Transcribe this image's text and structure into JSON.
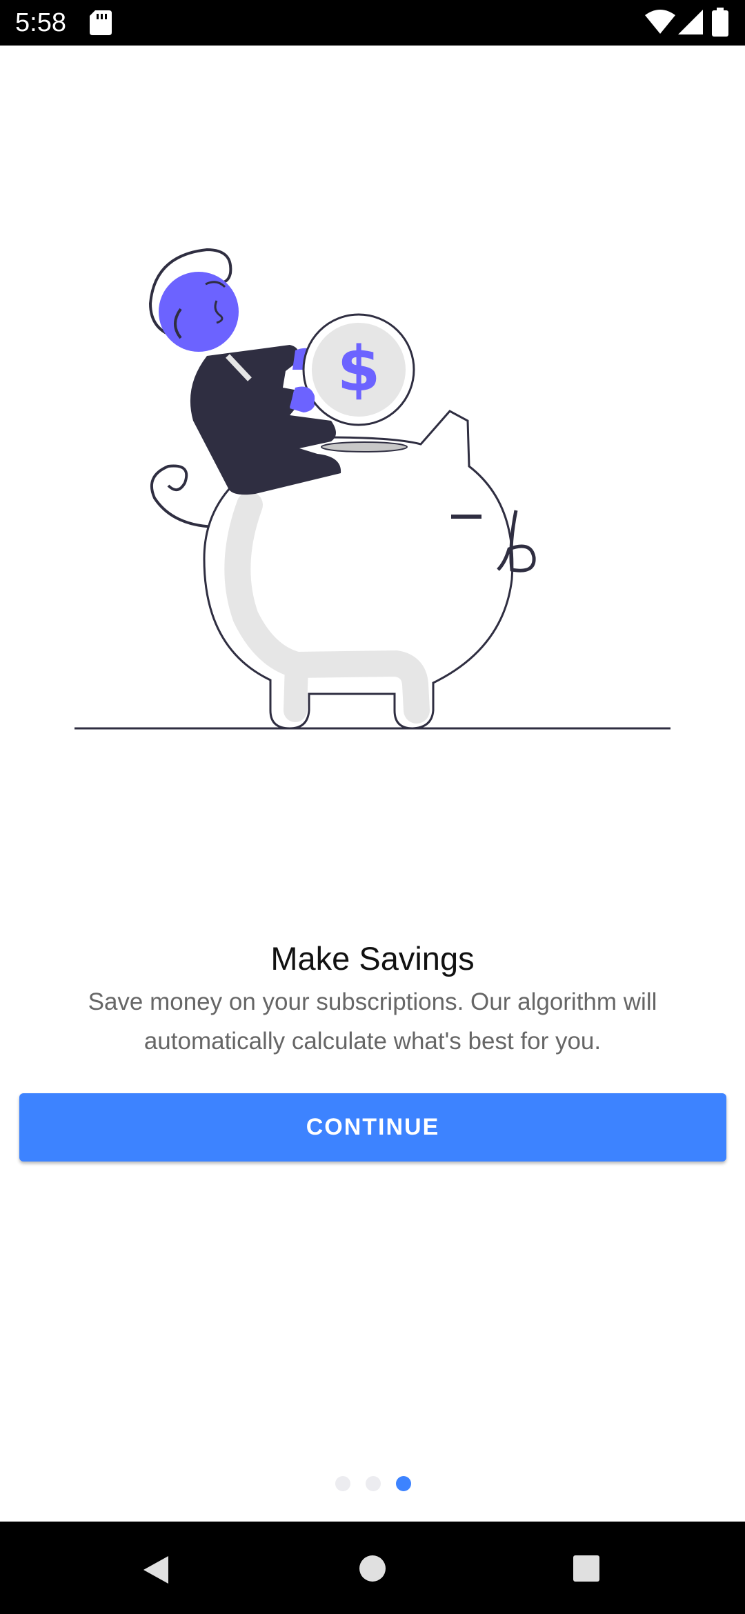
{
  "status_bar": {
    "time": "5:58",
    "icons": [
      "sd-card-icon",
      "wifi-icon",
      "cell-signal-icon",
      "battery-icon"
    ]
  },
  "onboarding": {
    "title": "Make Savings",
    "description": "Save money on your subscriptions. Our algorithm will automatically calculate what's best for you.",
    "continue_label": "CONTINUE",
    "illustration": "piggy-bank-illustration",
    "page_indicator": {
      "total": 3,
      "current": 3
    }
  },
  "colors": {
    "accent": "#3d83ff",
    "illustration_purple": "#6c63ff",
    "illustration_dark": "#2f2e41",
    "illustration_grey": "#e6e6e6"
  },
  "nav_bar": {
    "icons": [
      "back-icon",
      "home-icon",
      "recents-icon"
    ]
  }
}
